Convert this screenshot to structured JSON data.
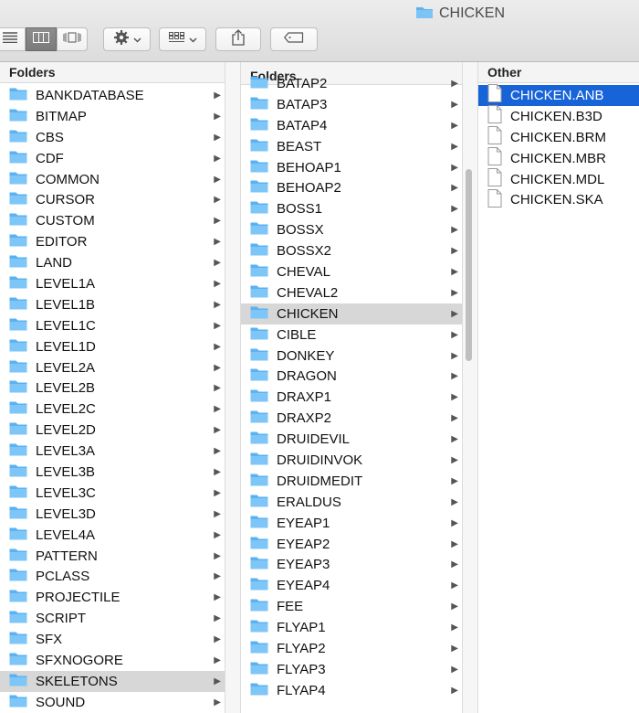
{
  "window": {
    "title": "CHICKEN",
    "title_icon": "folder-icon"
  },
  "toolbar": {
    "view_buttons": [
      "list-view-icon",
      "column-view-icon",
      "cover-flow-icon"
    ],
    "action_button": "gear-icon",
    "arrange_button": "grid-icon",
    "share_button": "share-icon",
    "tag_button": "tag-icon"
  },
  "colors": {
    "selection_blue": "#1763d8",
    "folder_blue": "#5ab2f2",
    "selection_gray": "#d7d7d7"
  },
  "columns": [
    {
      "header": "Folders",
      "items": [
        "BANKDATABASE",
        "BITMAP",
        "CBS",
        "CDF",
        "COMMON",
        "CURSOR",
        "CUSTOM",
        "EDITOR",
        "LAND",
        "LEVEL1A",
        "LEVEL1B",
        "LEVEL1C",
        "LEVEL1D",
        "LEVEL2A",
        "LEVEL2B",
        "LEVEL2C",
        "LEVEL2D",
        "LEVEL3A",
        "LEVEL3B",
        "LEVEL3C",
        "LEVEL3D",
        "LEVEL4A",
        "PATTERN",
        "PCLASS",
        "PROJECTILE",
        "SCRIPT",
        "SFX",
        "SFXNOGORE",
        "SKELETONS",
        "SOUND"
      ],
      "selected": "SKELETONS"
    },
    {
      "header": "Folders",
      "items": [
        "BATAP2",
        "BATAP3",
        "BATAP4",
        "BEAST",
        "BEHOAP1",
        "BEHOAP2",
        "BOSS1",
        "BOSSX",
        "BOSSX2",
        "CHEVAL",
        "CHEVAL2",
        "CHICKEN",
        "CIBLE",
        "DONKEY",
        "DRAGON",
        "DRAXP1",
        "DRAXP2",
        "DRUIDEVIL",
        "DRUIDINVOK",
        "DRUIDMEDIT",
        "ERALDUS",
        "EYEAP1",
        "EYEAP2",
        "EYEAP3",
        "EYEAP4",
        "FEE",
        "FLYAP1",
        "FLYAP2",
        "FLYAP3",
        "FLYAP4"
      ],
      "selected": "CHICKEN"
    },
    {
      "header": "Other",
      "items": [
        "CHICKEN.ANB",
        "CHICKEN.B3D",
        "CHICKEN.BRM",
        "CHICKEN.MBR",
        "CHICKEN.MDL",
        "CHICKEN.SKA"
      ],
      "selected": "CHICKEN.ANB"
    }
  ]
}
